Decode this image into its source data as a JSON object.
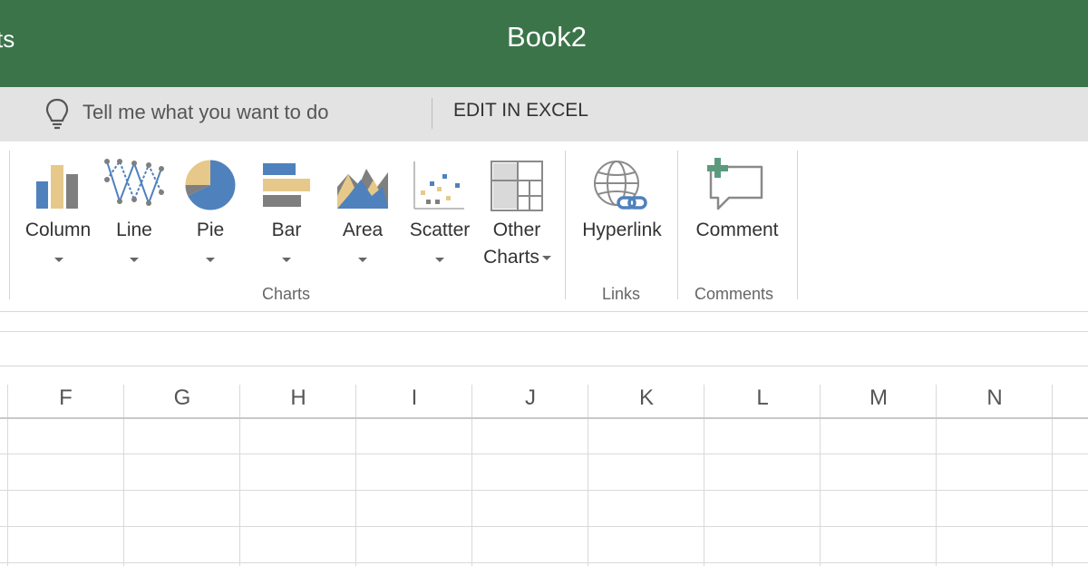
{
  "title_bar": {
    "left_tab_fragment": "ts",
    "document_title": "Book2"
  },
  "tell_me": {
    "text": "Tell me what you want to do",
    "icon": "lightbulb-icon"
  },
  "edit_in_excel": "EDIT IN EXCEL",
  "ribbon": {
    "charts_group": {
      "label": "Charts",
      "buttons": [
        {
          "label": "Column",
          "icon": "column-chart-icon"
        },
        {
          "label": "Line",
          "icon": "line-chart-icon"
        },
        {
          "label": "Pie",
          "icon": "pie-chart-icon"
        },
        {
          "label": "Bar",
          "icon": "bar-chart-icon"
        },
        {
          "label": "Area",
          "icon": "area-chart-icon"
        },
        {
          "label": "Scatter",
          "icon": "scatter-chart-icon"
        },
        {
          "label_line1": "Other",
          "label_line2": "Charts",
          "icon": "other-charts-icon"
        }
      ]
    },
    "links_group": {
      "label": "Links",
      "button": {
        "label": "Hyperlink",
        "icon": "hyperlink-icon"
      }
    },
    "comments_group": {
      "label": "Comments",
      "button": {
        "label": "Comment",
        "icon": "comment-icon"
      }
    }
  },
  "grid": {
    "columns": [
      "F",
      "G",
      "H",
      "I",
      "J",
      "K",
      "L",
      "M",
      "N"
    ]
  },
  "colors": {
    "title_bar": "#3b7449",
    "tell_bar": "#e3e3e3",
    "chart_blue": "#4f81bd",
    "chart_gold": "#e6c98a",
    "chart_gray": "#7f7f7f"
  }
}
